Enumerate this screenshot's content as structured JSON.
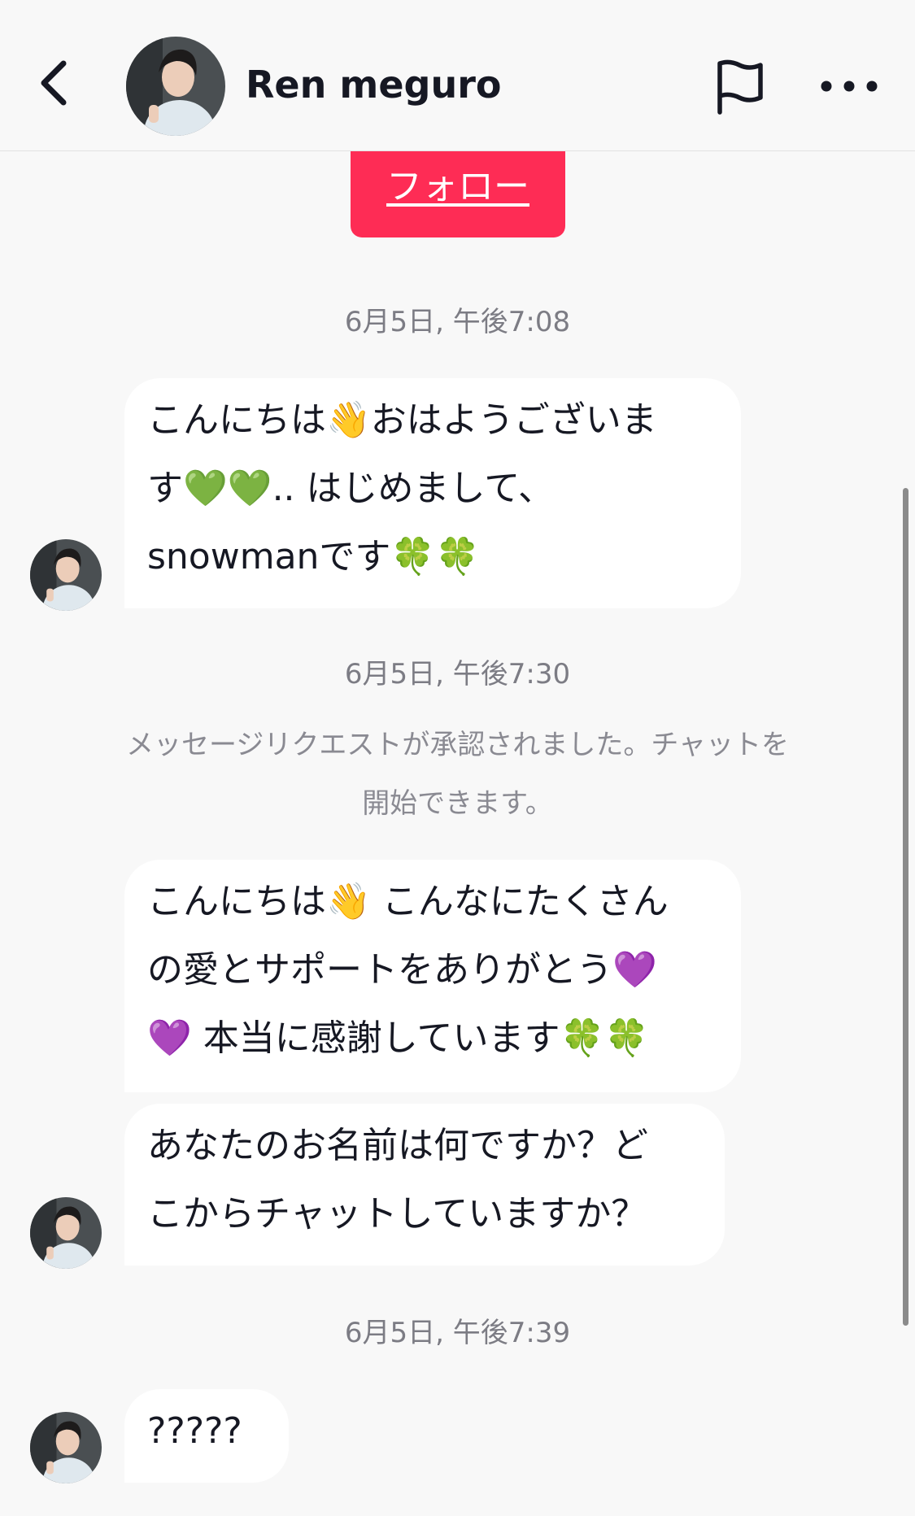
{
  "header": {
    "name": "Ren meguro",
    "back_icon": "chevron-left-icon",
    "report_icon": "flag-icon",
    "more_icon": "more-horizontal-icon"
  },
  "follow_button": {
    "label": "フォロー",
    "color": "#fe2c55"
  },
  "messages": [
    {
      "type": "timestamp",
      "text": "6月5日, 午後7:08"
    },
    {
      "type": "received",
      "text": "こんにちは👋おはようございま\nす💚💚.. はじめまして、\nsnowmanです🍀🍀"
    },
    {
      "type": "timestamp",
      "text": "6月5日, 午後7:30"
    },
    {
      "type": "system",
      "text": "メッセージリクエストが承認されました。チャットを開始できます。"
    },
    {
      "type": "received",
      "text": "こんにちは👋 こんなにたくさん\nの愛とサポートをありがとう💜\n💜 本当に感謝しています🍀🍀"
    },
    {
      "type": "received",
      "text": "あなたのお名前は何ですか？ど\nこからチャットしていますか？"
    },
    {
      "type": "timestamp",
      "text": "6月5日, 午後7:39"
    },
    {
      "type": "received",
      "text": "?????"
    }
  ]
}
